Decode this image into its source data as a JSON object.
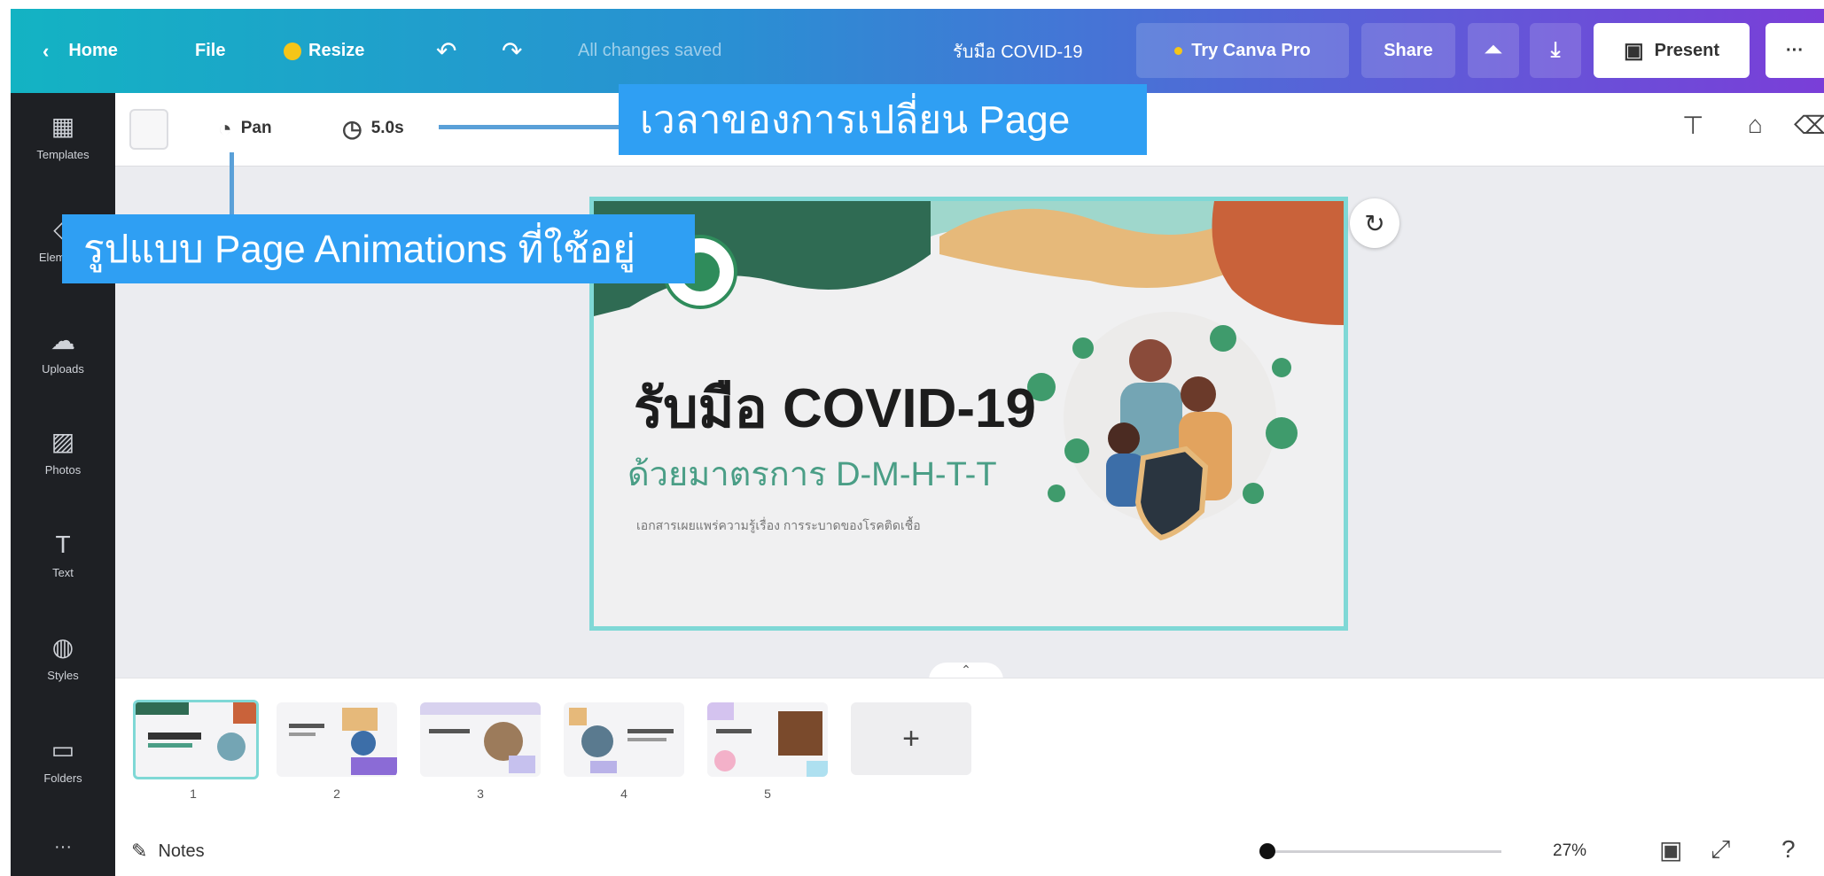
{
  "topbar": {
    "home": "Home",
    "file": "File",
    "resize": "Resize",
    "undo_icon": "undo-icon",
    "redo_icon": "redo-icon",
    "save_status": "All changes saved",
    "doc_title": "รับมือ COVID-19",
    "try_pro": "Try Canva Pro",
    "share": "Share",
    "present": "Present",
    "more": "···"
  },
  "sidebar": {
    "items": [
      {
        "label": "Templates",
        "icon": "templates-icon"
      },
      {
        "label": "Elements",
        "icon": "elements-icon"
      },
      {
        "label": "Uploads",
        "icon": "uploads-icon"
      },
      {
        "label": "Photos",
        "icon": "photos-icon"
      },
      {
        "label": "Text",
        "icon": "text-icon"
      },
      {
        "label": "Styles",
        "icon": "styles-icon"
      },
      {
        "label": "Folders",
        "icon": "folders-icon"
      },
      {
        "label": "···",
        "icon": "more-icon"
      }
    ]
  },
  "toolbar": {
    "animation": "Pan",
    "timing": "5.0s"
  },
  "callouts": {
    "timing": "เวลาของการเปลี่ยน Page",
    "animation": "รูปแบบ Page Animations ที่ใช้อยู่"
  },
  "slide": {
    "title": "รับมือ COVID-19",
    "subtitle": "ด้วยมาตรการ D-M-H-T-T",
    "small_text": "เอกสารเผยแพร่ความรู้เรื่อง การระบาดของโรคติดเชื้อ"
  },
  "filmstrip": {
    "pages": [
      "1",
      "2",
      "3",
      "4",
      "5"
    ],
    "add": "+"
  },
  "statusbar": {
    "notes": "Notes",
    "zoom": "27%",
    "zoom_fraction": 0.0
  },
  "colors": {
    "callout": "#2f9ff3",
    "selection": "#7fd8d6",
    "sidebar": "#1e2024"
  }
}
